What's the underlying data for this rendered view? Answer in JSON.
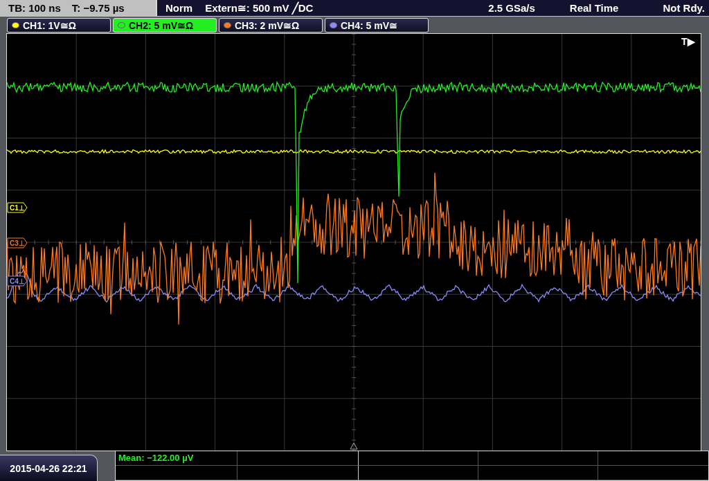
{
  "top_bar": {
    "timebase": "TB: 100 ns",
    "trigger_time": "T: −9.75 µs",
    "trigger_mode": "Norm",
    "trigger_source": "Extern≅: 500 mV ╱DC",
    "sample_rate": "2.5 GSa/s",
    "acquisition": "Real Time",
    "status": "Not Rdy."
  },
  "channels": [
    {
      "label": "CH1: 1V≅Ω",
      "color": "#ffff00",
      "selected": false,
      "marker": "C1⊥"
    },
    {
      "label": "CH2: 5 mV≅Ω",
      "color": "#22ee22",
      "selected": true
    },
    {
      "label": "CH3: 2 mV≅Ω",
      "color": "#ff7a1a",
      "selected": false,
      "marker": "C3⊥"
    },
    {
      "label": "CH4: 5 mV≅",
      "color": "#8c8cff",
      "selected": false,
      "marker": "C4⊥"
    }
  ],
  "trigger_marker": "T▶",
  "date_time": "2015-04-26 22:21",
  "measurement": "Mean: −122.00 µV"
}
